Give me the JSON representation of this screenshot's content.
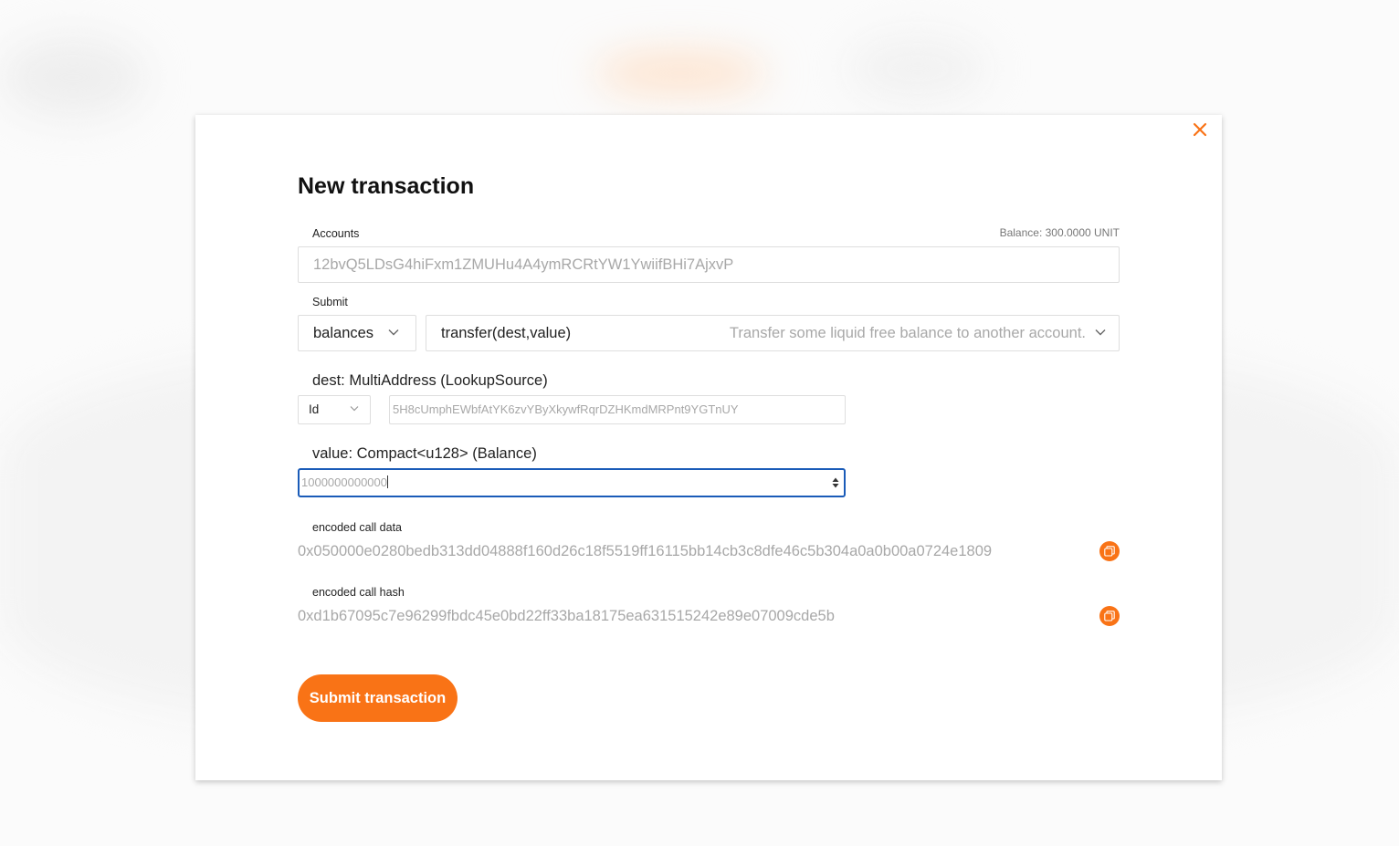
{
  "modal": {
    "title": "New transaction",
    "accounts_label": "Accounts",
    "balance": "Balance: 300.0000 UNIT",
    "account_value": "12bvQ5LDsG4hiFxm1ZMUHu4A4ymRCRtYW1YwiifBHi7AjxvP",
    "submit_label": "Submit",
    "module": "balances",
    "method": "transfer(dest,value)",
    "method_description": "Transfer some liquid free balance to another account.",
    "dest_label": "dest: MultiAddress (LookupSource)",
    "dest_type": "Id",
    "dest_value": "5H8cUmphEWbfAtYK6zvYByXkywfRqrDZHKmdMRPnt9YGTnUY",
    "value_label": "value: Compact<u128> (Balance)",
    "value": "1000000000000",
    "encoded_call_data_label": "encoded call data",
    "encoded_call_data": "0x050000e0280bedb313dd04888f160d26c18f5519ff16115bb14cb3c8dfe46c5b304a0a0b00a0724e1809",
    "encoded_call_hash_label": "encoded call hash",
    "encoded_call_hash": "0xd1b67095c7e96299fbdc45e0bd22ff33ba18175ea631515242e89e07009cde5b",
    "submit_button": "Submit transaction"
  },
  "icons": {
    "close": "close-icon",
    "chevron": "chevron-down-icon",
    "copy": "copy-icon",
    "spinner": "number-spinner-icon"
  },
  "colors": {
    "accent": "#f97316",
    "focus_border": "#1a5bb8",
    "placeholder": "#a8a8a8"
  }
}
